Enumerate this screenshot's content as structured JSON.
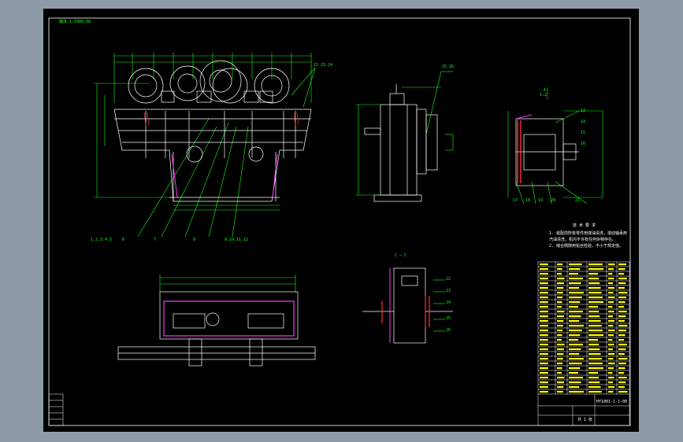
{
  "drawing": {
    "corner_label": "箱体 1:5000:08",
    "colors": {
      "frame": "#ffffff",
      "dimension": "#19ff19",
      "part": "#ffffff",
      "section": "#ff33ff",
      "hatch": "#ff3333",
      "table_text": "#ffff00",
      "background": "#000000"
    }
  },
  "front_view": {
    "part_labels": [
      "1.2.3.4.5",
      "6",
      "7",
      "8",
      "9.10.11.12"
    ],
    "top_callout": "22 23 24"
  },
  "side_view": {
    "callout": "25 26"
  },
  "detail_view": {
    "view_label": "A",
    "scale": "1:2",
    "callouts": [
      "13",
      "14",
      "15",
      "16",
      "17",
      "18",
      "19",
      "20",
      "21"
    ]
  },
  "section_view": {
    "view_label": "C — C",
    "callouts": [
      "22",
      "23",
      "24",
      "25",
      "26"
    ]
  },
  "tech_notes": {
    "title": "技 术 要 求",
    "lines": [
      "1. 装配前所有零件用煤油清洗，滚动轴承用",
      "汽油清洗，机内不许有任何杂物存在。",
      "2. 啮合侧隙用铅丝检验，不小于规定值。"
    ]
  },
  "title_block": {
    "drawing_number": "HY1001-1-1-00",
    "sheet": "共 1 张"
  }
}
